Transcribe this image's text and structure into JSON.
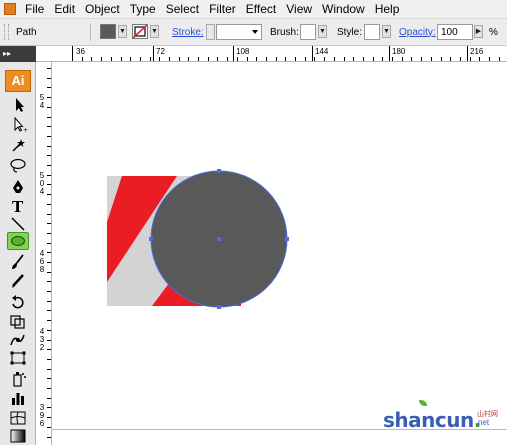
{
  "menu": {
    "items": [
      "File",
      "Edit",
      "Object",
      "Type",
      "Select",
      "Filter",
      "Effect",
      "View",
      "Window",
      "Help"
    ]
  },
  "control_bar": {
    "selection_label": "Path",
    "fill_color": "#595959",
    "stroke_label": "Stroke:",
    "brush_label": "Brush:",
    "style_label": "Style:",
    "opacity_label": "Opacity:",
    "opacity_value": "100",
    "percent": "%"
  },
  "tools": {
    "header": "▸▸",
    "logo": "Ai",
    "active_tool": "ellipse-tool",
    "accent": "#84d15b"
  },
  "rulers": {
    "top_labels": [
      "36",
      "72",
      "108",
      "144",
      "180",
      "216"
    ],
    "left_labels": [
      "5\n4",
      "5\n0\n4",
      "4\n6\n8",
      "4\n3\n2",
      "3\n9\n6"
    ]
  },
  "artwork": {
    "background_color": "#d3d3d3",
    "stripe_color": "#ea1c24",
    "circle_color": "#595959",
    "selection_color": "#4a6ee0"
  },
  "watermark": {
    "text_main": "shancun",
    "text_dot": ".",
    "text_suffix": "net",
    "text_cn": "山村网"
  }
}
